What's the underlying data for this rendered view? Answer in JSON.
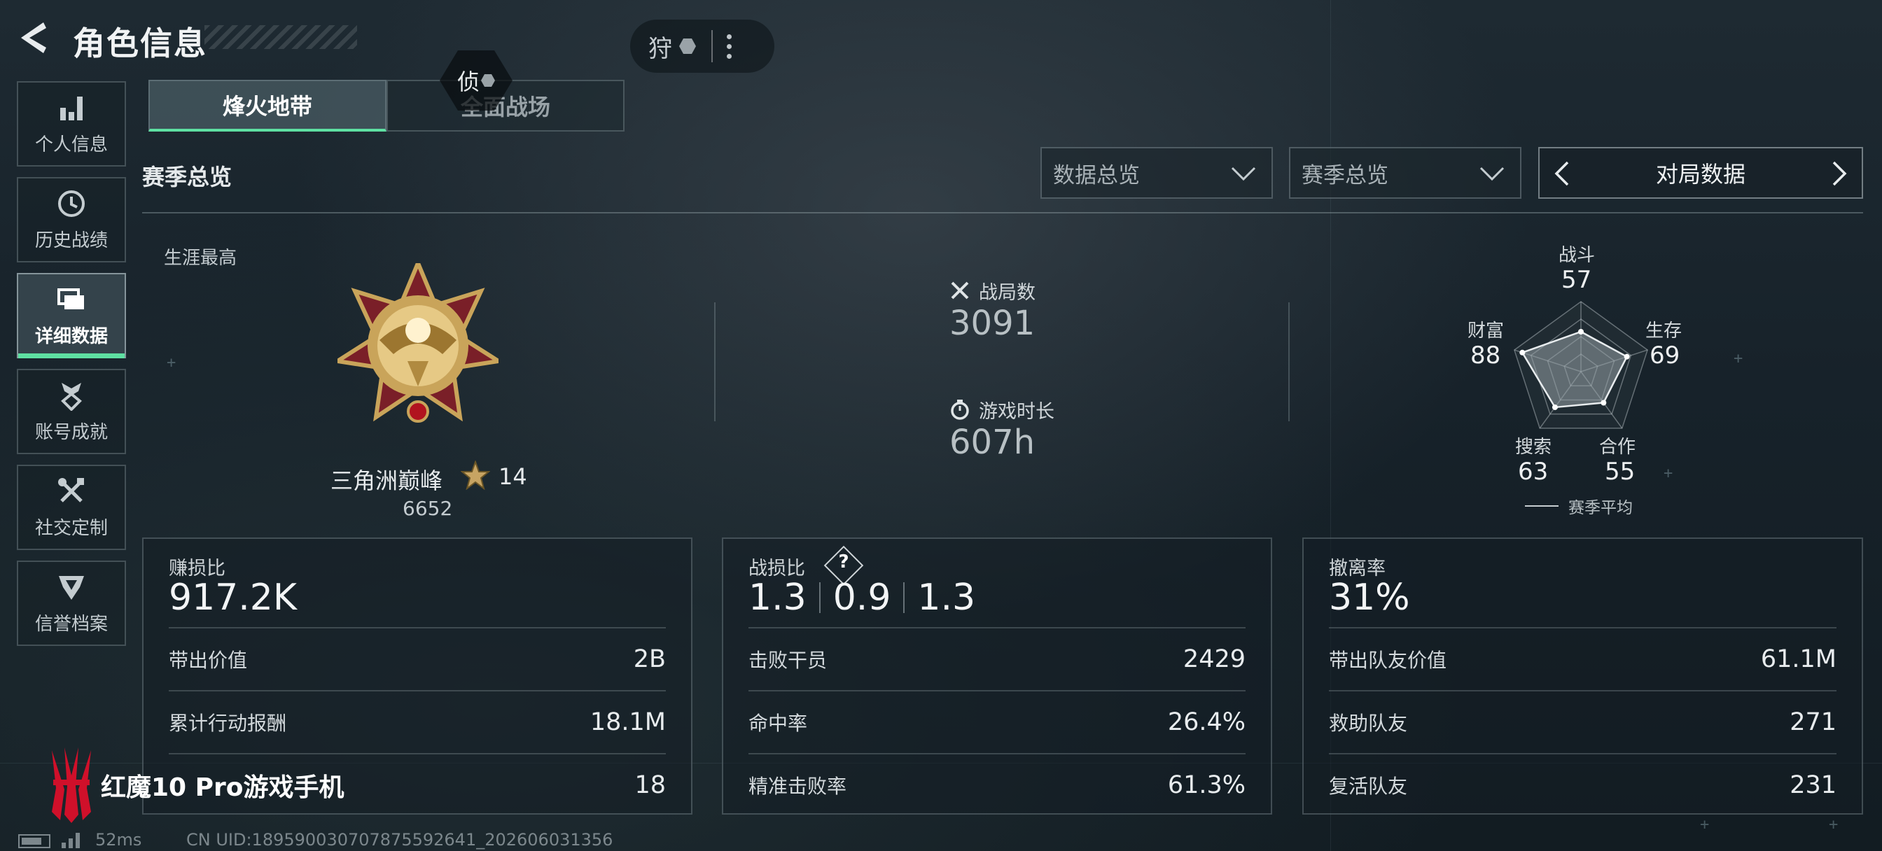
{
  "header": {
    "title": "角色信息",
    "pill_text": "狩",
    "float_badge_text": "侦"
  },
  "sidebar": {
    "items": [
      {
        "label": "个人信息",
        "icon": "bar-chart-icon"
      },
      {
        "label": "历史战绩",
        "icon": "history-clock-icon"
      },
      {
        "label": "详细数据",
        "icon": "folder-icon",
        "active": true
      },
      {
        "label": "账号成就",
        "icon": "achievement-icon"
      },
      {
        "label": "社交定制",
        "icon": "tools-icon"
      },
      {
        "label": "信誉档案",
        "icon": "reputation-icon"
      }
    ]
  },
  "tabs": [
    {
      "label": "烽火地带",
      "active": true
    },
    {
      "label": "全面战场",
      "active": false
    }
  ],
  "season": {
    "title": "赛季总览",
    "dropdown1": "数据总览",
    "dropdown2": "赛季总览",
    "switcher": "对局数据"
  },
  "overview": {
    "career_label": "生涯最高",
    "rank_name": "三角洲巅峰",
    "rank_stars": "14",
    "rank_score": "6652",
    "matches_label": "战局数",
    "matches_value": "3091",
    "playtime_label": "游戏时长",
    "playtime_value": "607h"
  },
  "radar": {
    "axes": [
      {
        "label": "战斗",
        "value": 57
      },
      {
        "label": "生存",
        "value": 69
      },
      {
        "label": "合作",
        "value": 55
      },
      {
        "label": "搜索",
        "value": 63
      },
      {
        "label": "财富",
        "value": 88
      }
    ],
    "legend": "赛季平均"
  },
  "cards": {
    "profit": {
      "label": "赚损比",
      "value": "917.2K",
      "rows": [
        {
          "k": "带出价值",
          "v": "2B"
        },
        {
          "k": "累计行动报酬",
          "v": "18.1M"
        },
        {
          "k": "",
          "v": "18"
        }
      ]
    },
    "kd": {
      "label": "战损比",
      "help": "?",
      "values": [
        "1.3",
        "0.9",
        "1.3"
      ],
      "rows": [
        {
          "k": "击败干员",
          "v": "2429"
        },
        {
          "k": "命中率",
          "v": "26.4%"
        },
        {
          "k": "精准击败率",
          "v": "61.3%"
        }
      ]
    },
    "extract": {
      "label": "撤离率",
      "value": "31%",
      "rows": [
        {
          "k": "带出队友价值",
          "v": "61.1M"
        },
        {
          "k": "救助队友",
          "v": "271"
        },
        {
          "k": "复活队友",
          "v": "231"
        }
      ]
    }
  },
  "watermark": {
    "text": "红魔10 Pro游戏手机"
  },
  "footer": {
    "ping": "52ms",
    "uid": "CN UID:18959003070787559264​1_202606031356"
  },
  "colors": {
    "accent": "#5ee0a2",
    "brand_red": "#d0102a"
  }
}
